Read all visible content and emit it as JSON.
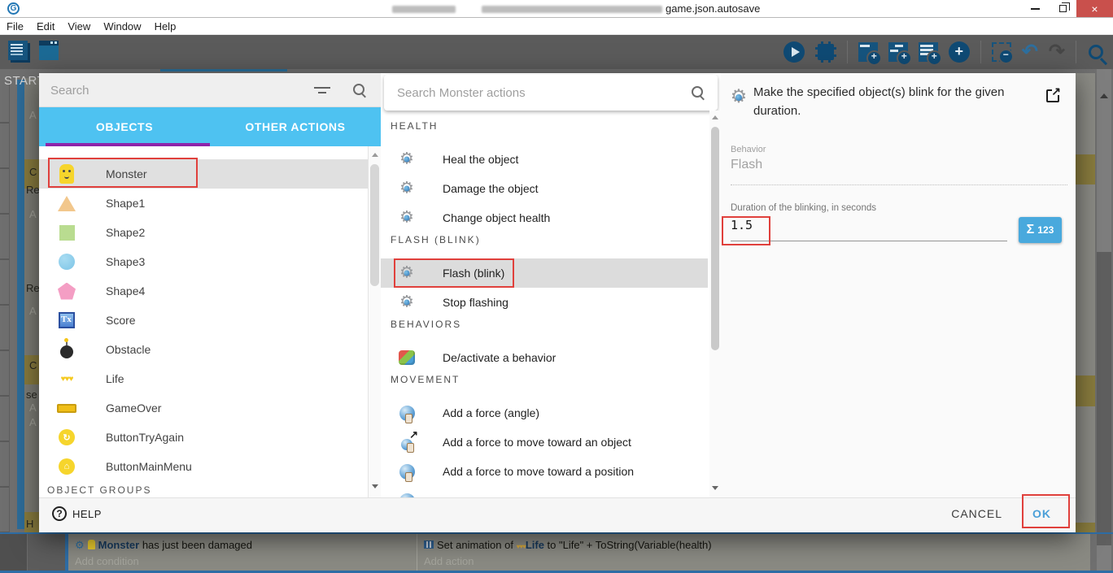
{
  "window": {
    "title_suffix": "game.json.autosave"
  },
  "menubar": {
    "items": [
      "File",
      "Edit",
      "View",
      "Window",
      "Help"
    ]
  },
  "toolbar": {
    "icons": [
      "project-manager",
      "scene-editor",
      "preview-play",
      "debug",
      "add-standard-event",
      "add-sub-event",
      "add-comment",
      "add-event-circle",
      "remove-event",
      "undo",
      "redo",
      "search"
    ]
  },
  "background": {
    "tab_label": "START",
    "event_fragments": [
      "A",
      "C",
      "Re",
      "A",
      "Re",
      "A",
      "C",
      "se",
      "A",
      "A",
      "H"
    ]
  },
  "dialog": {
    "objects_panel": {
      "search_placeholder": "Search",
      "tabs": [
        {
          "label": "OBJECTS"
        },
        {
          "label": "OTHER ACTIONS"
        }
      ],
      "items": [
        {
          "label": "Monster"
        },
        {
          "label": "Shape1"
        },
        {
          "label": "Shape2"
        },
        {
          "label": "Shape3"
        },
        {
          "label": "Shape4"
        },
        {
          "label": "Score"
        },
        {
          "label": "Obstacle"
        },
        {
          "label": "Life"
        },
        {
          "label": "GameOver"
        },
        {
          "label": "ButtonTryAgain"
        },
        {
          "label": "ButtonMainMenu"
        }
      ],
      "groups_header": "OBJECT GROUPS"
    },
    "actions_panel": {
      "search_placeholder": "Search Monster actions",
      "sections": [
        {
          "header": "HEALTH",
          "items": [
            "Heal the object",
            "Damage the object",
            "Change object health"
          ]
        },
        {
          "header": "FLASH (BLINK)",
          "items": [
            "Flash (blink)",
            "Stop flashing"
          ]
        },
        {
          "header": "BEHAVIORS",
          "items": [
            "De/activate a behavior"
          ]
        },
        {
          "header": "MOVEMENT",
          "items": [
            "Add a force (angle)",
            "Add a force to move toward an object",
            "Add a force to move toward a position"
          ]
        }
      ]
    },
    "details_panel": {
      "description": "Make the specified object(s) blink for the given duration.",
      "behavior_label": "Behavior",
      "behavior_value": "Flash",
      "duration_label": "Duration of the blinking, in seconds",
      "duration_value": "1.5",
      "expression_sigma": "Σ",
      "expression_label": "123"
    },
    "footer": {
      "help": "HELP",
      "cancel": "CANCEL",
      "ok": "OK"
    }
  },
  "events": {
    "condition": {
      "object": "Monster",
      "text": " has just been damaged",
      "placeholder": "Add condition"
    },
    "action": {
      "prefix": "Set animation of ",
      "object": "Life",
      "suffix": " to \"Life\" + ToString(Variable(health)",
      "placeholder": "Add action"
    }
  },
  "colors": {
    "tab_bar": "#4ec2f1",
    "tab_underline": "#8e24aa",
    "annotation": "#e0403c",
    "ok_text": "#4a9fd8",
    "expression_button": "#49a9dd"
  }
}
